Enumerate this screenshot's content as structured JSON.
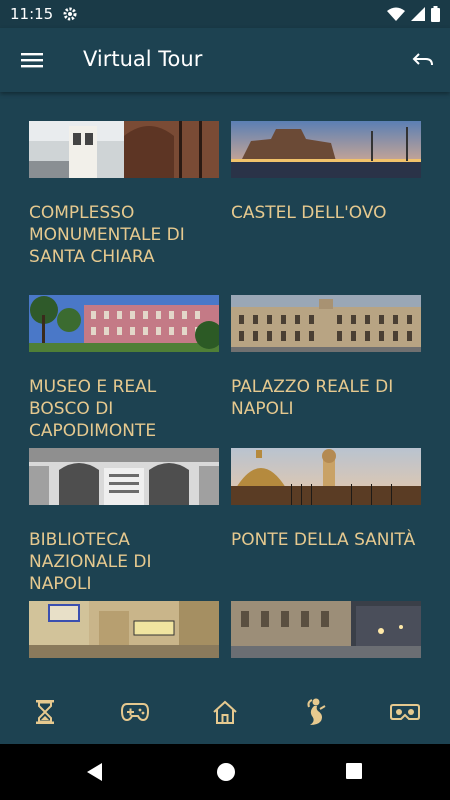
{
  "status_bar": {
    "time": "11:15",
    "icons": [
      "gear-icon",
      "wifi-icon",
      "signal-icon",
      "battery-icon"
    ]
  },
  "app_bar": {
    "title": "Virtual Tour",
    "left_icon": "menu-icon",
    "right_icon": "back-arrow-icon"
  },
  "tiles": [
    {
      "label": "COMPLESSO MONUMENTALE DI SANTA CHIARA"
    },
    {
      "label": "CASTEL DELL'OVO"
    },
    {
      "label": "MUSEO E REAL BOSCO DI CAPODIMONTE"
    },
    {
      "label": "PALAZZO REALE DI NAPOLI"
    },
    {
      "label": "BIBLIOTECA NAZIONALE DI NAPOLI"
    },
    {
      "label": "PONTE DELLA SANITÀ"
    },
    {
      "label": ""
    },
    {
      "label": ""
    }
  ],
  "bottom_nav": [
    "hourglass-icon",
    "gamepad-icon",
    "home-icon",
    "mermaid-icon",
    "vr-headset-icon"
  ],
  "colors": {
    "background": "#1d4251",
    "label": "#e6c98f",
    "icon": "#e6c98f"
  }
}
